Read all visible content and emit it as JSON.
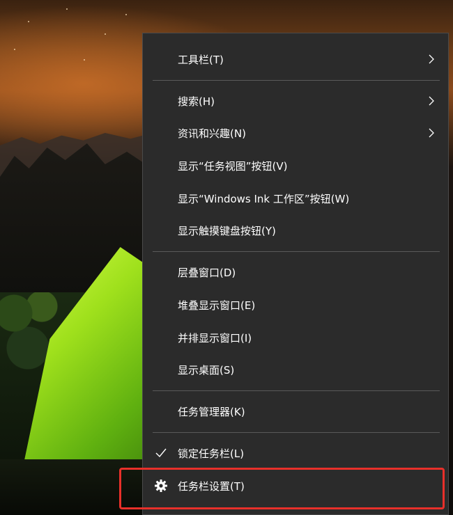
{
  "menu": {
    "items": [
      {
        "label": "工具栏(T)",
        "submenu": true
      },
      {
        "label": "搜索(H)",
        "submenu": true
      },
      {
        "label": "资讯和兴趣(N)",
        "submenu": true
      },
      {
        "label": "显示“任务视图”按钮(V)",
        "submenu": false
      },
      {
        "label": "显示“Windows Ink 工作区”按钮(W)",
        "submenu": false
      },
      {
        "label": "显示触摸键盘按钮(Y)",
        "submenu": false
      },
      {
        "label": "层叠窗口(D)",
        "submenu": false
      },
      {
        "label": "堆叠显示窗口(E)",
        "submenu": false
      },
      {
        "label": "并排显示窗口(I)",
        "submenu": false
      },
      {
        "label": "显示桌面(S)",
        "submenu": false
      },
      {
        "label": "任务管理器(K)",
        "submenu": false
      },
      {
        "label": "锁定任务栏(L)",
        "checked": true
      },
      {
        "label": "任务栏设置(T)",
        "icon": "gear-icon",
        "highlighted": true
      }
    ]
  },
  "colors": {
    "menu_bg": "#2b2b2b",
    "separator": "#5a5a5a",
    "text": "#ffffff",
    "highlight_border": "#e8302a"
  }
}
